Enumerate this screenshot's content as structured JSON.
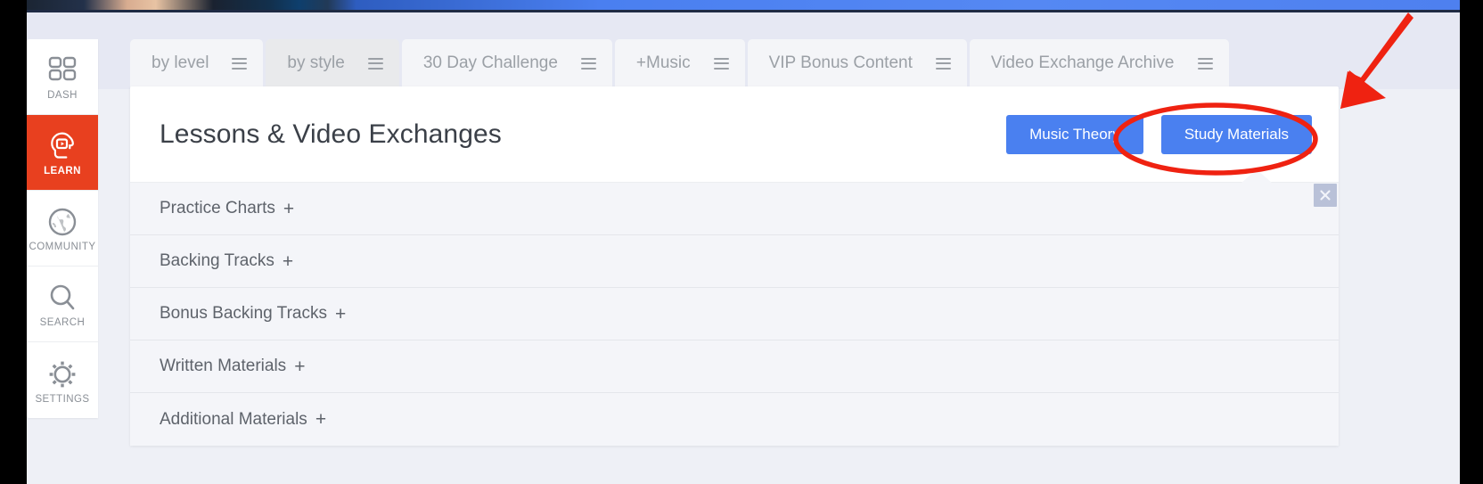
{
  "app": {
    "title": "Lessons & Video Exchanges"
  },
  "sidebar": {
    "items": [
      {
        "label": "DASH",
        "icon": "grid-icon",
        "active": false
      },
      {
        "label": "LEARN",
        "icon": "brain-play-icon",
        "active": true
      },
      {
        "label": "COMMUNITY",
        "icon": "globe-icon",
        "active": false
      },
      {
        "label": "SEARCH",
        "icon": "magnifier-icon",
        "active": false
      },
      {
        "label": "SETTINGS",
        "icon": "gear-icon",
        "active": false
      }
    ],
    "active_color": "#e8401f"
  },
  "tabs": [
    {
      "label": "by level",
      "menu_icon": "hamburger-icon",
      "style": "light"
    },
    {
      "label": "by style",
      "menu_icon": "hamburger-icon",
      "style": "alt"
    },
    {
      "label": "30 Day Challenge",
      "menu_icon": "hamburger-icon",
      "style": "light"
    },
    {
      "label": "+Music",
      "menu_icon": "hamburger-icon",
      "style": "light"
    },
    {
      "label": "VIP Bonus Content",
      "menu_icon": "hamburger-icon",
      "style": "light"
    },
    {
      "label": "Video Exchange Archive",
      "menu_icon": "hamburger-icon",
      "style": "light"
    }
  ],
  "header_buttons": [
    {
      "label": "Music Theory",
      "color": "#4a80f0"
    },
    {
      "label": "Study Materials",
      "color": "#4a80f0",
      "highlighted": true
    }
  ],
  "accordion": {
    "expand_glyph": "+",
    "rows": [
      {
        "label": "Practice Charts"
      },
      {
        "label": "Backing Tracks"
      },
      {
        "label": "Bonus Backing Tracks"
      },
      {
        "label": "Written Materials"
      },
      {
        "label": "Additional Materials"
      }
    ]
  },
  "close_button": {
    "icon": "close-icon",
    "glyph": "×"
  },
  "annotation": {
    "color": "#ef2211",
    "shapes": [
      "arrow",
      "ellipse"
    ],
    "target": "Study Materials"
  }
}
